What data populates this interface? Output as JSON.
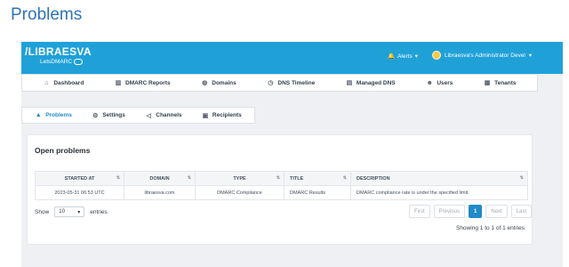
{
  "page_heading": "Problems",
  "app": {
    "logo_main": "/LIBRAESVA",
    "logo_sub": "LetsDMARC",
    "alerts_label": "Alerts",
    "user_label": "Libraesva's Administrator Devel"
  },
  "nav": [
    {
      "label": "Dashboard",
      "icon": "home-icon"
    },
    {
      "label": "DMARC Reports",
      "icon": "bar-chart-icon"
    },
    {
      "label": "Domains",
      "icon": "globe-icon"
    },
    {
      "label": "DNS Timeline",
      "icon": "clock-icon"
    },
    {
      "label": "Managed DNS",
      "icon": "database-icon"
    },
    {
      "label": "Users",
      "icon": "users-icon"
    },
    {
      "label": "Tenants",
      "icon": "building-icon"
    }
  ],
  "tabs": [
    {
      "label": "Problems",
      "icon": "warning-icon",
      "active": true
    },
    {
      "label": "Settings",
      "icon": "gear-icon"
    },
    {
      "label": "Channels",
      "icon": "megaphone-icon"
    },
    {
      "label": "Recipients",
      "icon": "address-card-icon"
    }
  ],
  "card": {
    "title": "Open problems",
    "columns": [
      "STARTED AT",
      "DOMAIN",
      "TYPE",
      "TITLE",
      "DESCRIPTION"
    ],
    "rows": [
      [
        "2023-05-31 06:53 UTC",
        "libraesva.com",
        "DMARC Compliance",
        "DMARC Results",
        "DMARC compliance rate is under the specified limit."
      ]
    ],
    "show_label": "Show",
    "entries_value": "10",
    "entries_label": "entries",
    "pagination": [
      "First",
      "Previous",
      "1",
      "Next",
      "Last"
    ],
    "active_page": "1",
    "info": "Showing 1 to 1 of 1 entries"
  }
}
